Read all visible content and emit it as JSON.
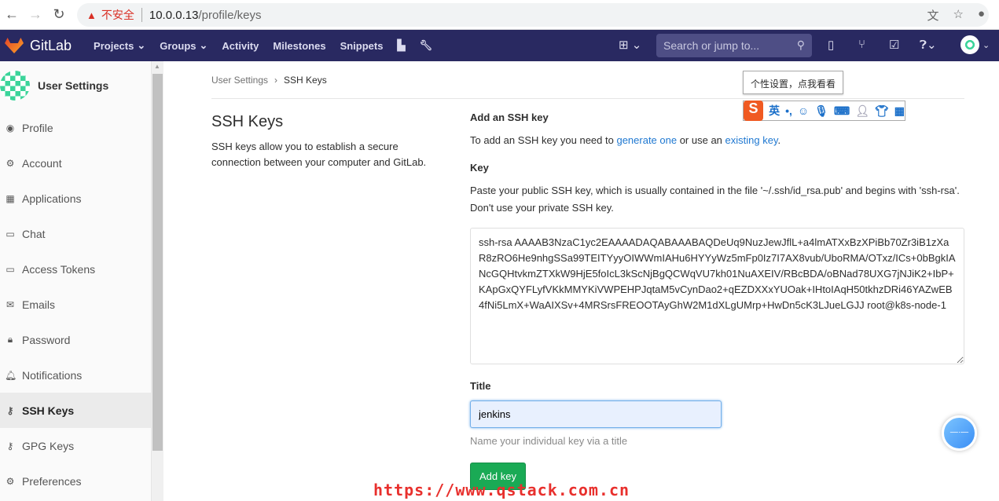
{
  "browser": {
    "insecure_label": "不安全",
    "host": "10.0.0.13",
    "path": "/profile/keys"
  },
  "nav": {
    "brand": "GitLab",
    "links": [
      "Projects",
      "Groups",
      "Activity",
      "Milestones",
      "Snippets"
    ],
    "search_placeholder": "Search or jump to..."
  },
  "sidebar": {
    "title": "User Settings",
    "items": [
      {
        "label": "Profile",
        "icon": "profile-icon"
      },
      {
        "label": "Account",
        "icon": "account-icon"
      },
      {
        "label": "Applications",
        "icon": "applications-icon"
      },
      {
        "label": "Chat",
        "icon": "chat-icon"
      },
      {
        "label": "Access Tokens",
        "icon": "token-icon"
      },
      {
        "label": "Emails",
        "icon": "email-icon"
      },
      {
        "label": "Password",
        "icon": "lock-icon"
      },
      {
        "label": "Notifications",
        "icon": "bell-icon"
      },
      {
        "label": "SSH Keys",
        "icon": "key-icon",
        "active": true
      },
      {
        "label": "GPG Keys",
        "icon": "key-icon"
      },
      {
        "label": "Preferences",
        "icon": "preferences-icon"
      }
    ]
  },
  "breadcrumb": [
    "User Settings",
    "SSH Keys"
  ],
  "left": {
    "title": "SSH Keys",
    "description": "SSH keys allow you to establish a secure connection between your computer and GitLab."
  },
  "form": {
    "heading": "Add an SSH key",
    "intro_pre": "To add an SSH key you need to ",
    "intro_link1": "generate one",
    "intro_mid": " or use an ",
    "intro_link2": "existing key",
    "intro_post": ".",
    "key_label": "Key",
    "key_help": "Paste your public SSH key, which is usually contained in the file '~/.ssh/id_rsa.pub' and begins with 'ssh-rsa'. Don't use your private SSH key.",
    "key_value": "ssh-rsa AAAAB3NzaC1yc2EAAAADAQABAAABAQDeUq9NuzJewJflL+a4lmATXxBzXPiBb70Zr3iB1zXaR8zRO6He9nhgSSa99TEITYyyOIWWmIAHu6HYYyWz5mFp0Iz7I7AX8vub/UboRMA/OTxz/ICs+0bBgkIANcGQHtvkmZTXkW9HjE5foIcL3kScNjBgQCWqVU7kh01NuAXEIV/RBcBDA/oBNad78UXG7jNJiK2+IbP+KApGxQYFLyfVKkMMYKiVWPEHPJqtaM5vCynDao2+qEZDXXxYUOak+IHtoIAqH50tkhzDRi46YAZwEB4fNi5LmX+WaAIXSv+4MRSrsFREOOTAyGhW2M1dXLgUMrp+HwDn5cK3LJueLGJJ root@k8s-node-1",
    "title_label": "Title",
    "title_value": "jenkins",
    "title_help": "Name your individual key via a title",
    "submit": "Add key"
  },
  "ime": {
    "tooltip": "个性设置，点我看看",
    "lang": "英"
  },
  "watermark": "https://www.qstack.com.cn"
}
